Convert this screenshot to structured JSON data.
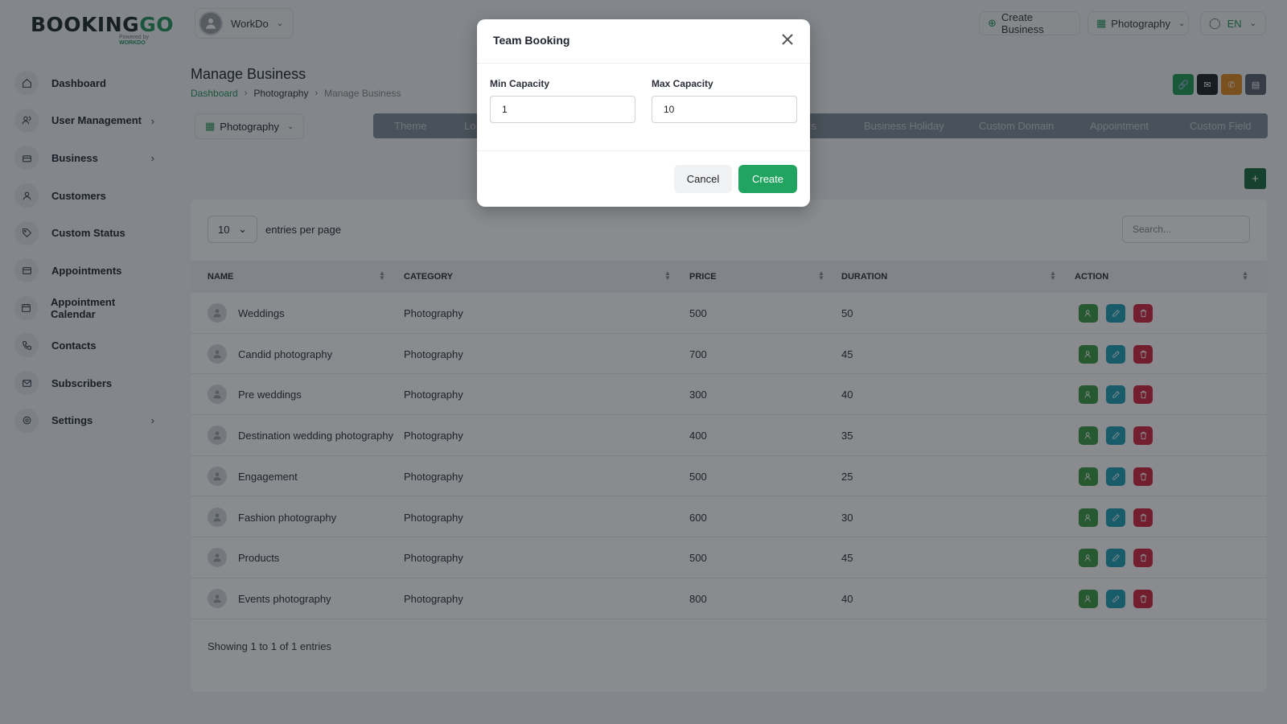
{
  "brand": {
    "logo_main_a": "BOOKING",
    "logo_main_b": "GO",
    "logo_sub_a": "Powered by",
    "logo_sub_b": "WORKDO"
  },
  "sidebar": {
    "items": [
      {
        "label": "Dashboard",
        "icon": "home-icon",
        "chevron": false
      },
      {
        "label": "User Management",
        "icon": "users-icon",
        "chevron": true
      },
      {
        "label": "Business",
        "icon": "briefcase-icon",
        "chevron": true
      },
      {
        "label": "Customers",
        "icon": "user-icon",
        "chevron": false
      },
      {
        "label": "Custom Status",
        "icon": "tag-icon",
        "chevron": false
      },
      {
        "label": "Appointments",
        "icon": "card-icon",
        "chevron": false
      },
      {
        "label": "Appointment Calendar",
        "icon": "calendar-icon",
        "chevron": false
      },
      {
        "label": "Contacts",
        "icon": "phone-icon",
        "chevron": false
      },
      {
        "label": "Subscribers",
        "icon": "mail-icon",
        "chevron": false
      },
      {
        "label": "Settings",
        "icon": "gear-icon",
        "chevron": true
      }
    ]
  },
  "header": {
    "user_name": "WorkDo",
    "create_business": "Create Business",
    "business_selector": "Photography",
    "language": "EN"
  },
  "page": {
    "title": "Manage Business",
    "breadcrumb": [
      "Dashboard",
      "Photography",
      "Manage Business"
    ],
    "business_select": "Photography",
    "tabs": [
      "Theme",
      "Lo",
      "rs",
      "Business Holiday",
      "Custom Domain",
      "Appointment",
      "Custom Field"
    ]
  },
  "table": {
    "entries_value": "10",
    "entries_label": "entries per page",
    "search_placeholder": "Search...",
    "columns": [
      "NAME",
      "CATEGORY",
      "PRICE",
      "DURATION",
      "ACTION"
    ],
    "rows": [
      {
        "name": "Weddings",
        "category": "Photography",
        "price": "500",
        "duration": "50"
      },
      {
        "name": "Candid photography",
        "category": "Photography",
        "price": "700",
        "duration": "45"
      },
      {
        "name": "Pre weddings",
        "category": "Photography",
        "price": "300",
        "duration": "40"
      },
      {
        "name": "Destination wedding photography",
        "category": "Photography",
        "price": "400",
        "duration": "35"
      },
      {
        "name": "Engagement",
        "category": "Photography",
        "price": "500",
        "duration": "25"
      },
      {
        "name": "Fashion photography",
        "category": "Photography",
        "price": "600",
        "duration": "30"
      },
      {
        "name": "Products",
        "category": "Photography",
        "price": "500",
        "duration": "45"
      },
      {
        "name": "Events photography",
        "category": "Photography",
        "price": "800",
        "duration": "40"
      }
    ],
    "footer": "Showing 1 to 1 of 1 entries"
  },
  "modal": {
    "title": "Team Booking",
    "min_label": "Min Capacity",
    "min_value": "1",
    "max_label": "Max Capacity",
    "max_value": "10",
    "cancel": "Cancel",
    "create": "Create"
  },
  "colors": {
    "accent": "#23945a",
    "action_team": "#3a9b43",
    "action_edit": "#1c9fb5",
    "action_delete": "#d3253f"
  }
}
